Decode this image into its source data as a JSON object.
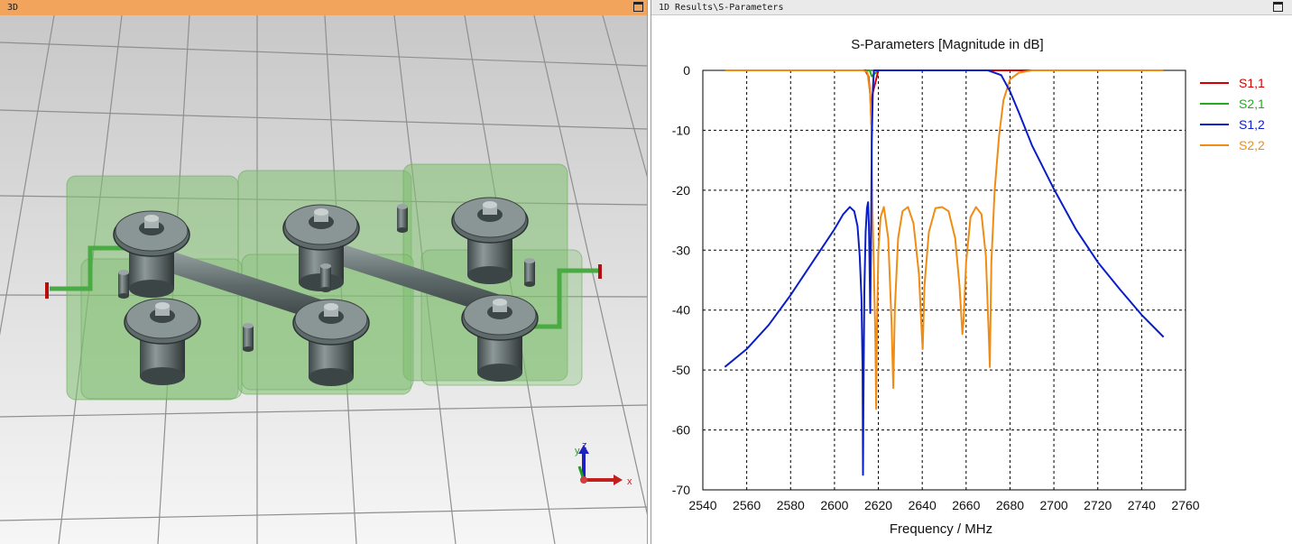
{
  "left_panel": {
    "title": "3D",
    "axes_labels": {
      "x": "x",
      "y": "y",
      "z": "z"
    }
  },
  "right_panel": {
    "title": "1D Results\\S-Parameters"
  },
  "colors": {
    "s11": "#d40000",
    "s21": "#22aa22",
    "s12": "#0a1ec8",
    "s22": "#f08c14",
    "left_title_bg": "#f2a35c"
  },
  "chart_data": {
    "type": "line",
    "title": "S-Parameters [Magnitude in dB]",
    "xlabel": "Frequency / MHz",
    "ylabel": "",
    "xlim": [
      2540,
      2760
    ],
    "ylim": [
      -70,
      0
    ],
    "xticks": [
      2540,
      2560,
      2580,
      2600,
      2620,
      2640,
      2660,
      2680,
      2700,
      2720,
      2740,
      2760
    ],
    "yticks": [
      0,
      -10,
      -20,
      -30,
      -40,
      -50,
      -60,
      -70
    ],
    "grid": true,
    "legend": "right",
    "series": [
      {
        "name": "S1,1",
        "color": "#d40000",
        "x": [
          2550,
          2600,
          2610,
          2614,
          2615.5,
          2616.3,
          2616.8,
          2617.3,
          2620,
          2750
        ],
        "y": [
          0,
          0,
          0,
          0,
          -1,
          -4,
          -9,
          -4,
          0,
          0
        ]
      },
      {
        "name": "S2,1",
        "color": "#22aa22",
        "x": [
          2550,
          2600,
          2613,
          2616,
          2617,
          2620,
          2680,
          2750
        ],
        "y": [
          0,
          0,
          0,
          0,
          -1,
          0,
          0,
          0
        ]
      },
      {
        "name": "S1,2",
        "color": "#0a1ec8",
        "x": [
          2550,
          2560,
          2570,
          2580,
          2590,
          2600,
          2604,
          2607,
          2609,
          2610.5,
          2611.5,
          2612.3,
          2612.8,
          2613.0,
          2613.2,
          2613.6,
          2614.2,
          2614.8,
          2615.3,
          2615.7,
          2616.0,
          2616.3,
          2616.6,
          2617.0,
          2617.5,
          2618,
          2620,
          2650,
          2670,
          2676,
          2680,
          2684,
          2690,
          2700,
          2710,
          2720,
          2730,
          2740,
          2750
        ],
        "y": [
          -49.5,
          -46.5,
          -42.5,
          -37.5,
          -32,
          -26.5,
          -24,
          -22.8,
          -23.5,
          -26,
          -31,
          -38,
          -50,
          -67.5,
          -55,
          -37,
          -27,
          -23,
          -22,
          -26,
          -33,
          -40.5,
          -30,
          -12,
          -3,
          0,
          0,
          0,
          0,
          -0.8,
          -3.5,
          -7,
          -12.5,
          -19.8,
          -26.5,
          -32,
          -36.5,
          -40.8,
          -44.5
        ]
      },
      {
        "name": "S2,2",
        "color": "#f08c14",
        "x": [
          2550,
          2600,
          2613,
          2615,
          2616.3,
          2616.8,
          2617.3,
          2618.0,
          2618.6,
          2619.0,
          2619.4,
          2620.0,
          2621.0,
          2622.5,
          2624.5,
          2626.0,
          2626.8,
          2627.5,
          2629.0,
          2631.0,
          2633.5,
          2636.0,
          2638.5,
          2639.8,
          2640.2,
          2641.0,
          2643.0,
          2646.0,
          2649.0,
          2652.0,
          2655.0,
          2657.0,
          2658.3,
          2658.8,
          2660.0,
          2662.0,
          2664.5,
          2667.0,
          2669.0,
          2670.4,
          2670.8,
          2671.5,
          2673.0,
          2675.0,
          2677.0,
          2680.0,
          2684.0,
          2690.0,
          2700.0,
          2750.0
        ],
        "y": [
          0,
          0,
          0,
          -0.3,
          -4,
          -9,
          -23,
          -34,
          -44,
          -56.5,
          -42,
          -30,
          -24.5,
          -22.8,
          -28,
          -42,
          -53,
          -40,
          -28,
          -23.5,
          -22.8,
          -25.5,
          -34,
          -44,
          -46.5,
          -36,
          -27,
          -23,
          -22.8,
          -23.5,
          -28,
          -36,
          -44,
          -42,
          -32,
          -24.5,
          -22.8,
          -24,
          -31,
          -45,
          -49.5,
          -32,
          -20,
          -11,
          -5,
          -1.5,
          -0.4,
          0,
          0,
          0
        ]
      }
    ]
  }
}
